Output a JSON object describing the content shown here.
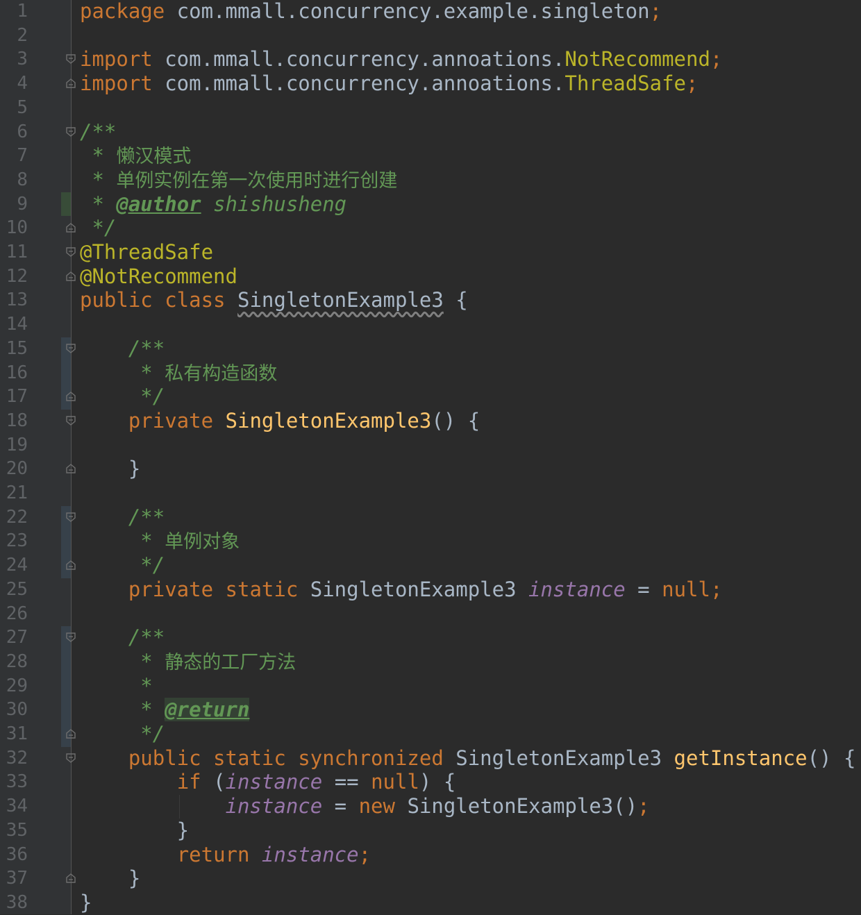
{
  "editor": {
    "file_language": "java",
    "colors": {
      "background": "#2b2b2b",
      "keyword": "#cc7832",
      "annotation": "#bbb529",
      "method": "#ffc66d",
      "field": "#9876aa",
      "doc_comment": "#629755",
      "line_number": "#606366"
    }
  },
  "lines": [
    {
      "n": "1",
      "tokens": [
        [
          "kw",
          "package"
        ],
        [
          "plain",
          " com.mmall.concurrency.example.singleton"
        ],
        [
          "kw",
          ";"
        ]
      ]
    },
    {
      "n": "2",
      "tokens": []
    },
    {
      "n": "3",
      "fold": "open",
      "tokens": [
        [
          "kw",
          "import"
        ],
        [
          "plain",
          " com.mmall.concurrency.annoations."
        ],
        [
          "ann",
          "NotRecommend"
        ],
        [
          "kw",
          ";"
        ]
      ]
    },
    {
      "n": "4",
      "fold": "close",
      "tokens": [
        [
          "kw",
          "import"
        ],
        [
          "plain",
          " com.mmall.concurrency.annoations."
        ],
        [
          "ann",
          "ThreadSafe"
        ],
        [
          "kw",
          ";"
        ]
      ]
    },
    {
      "n": "5",
      "tokens": []
    },
    {
      "n": "6",
      "fold": "open",
      "tokens": [
        [
          "doc",
          "/**"
        ]
      ]
    },
    {
      "n": "7",
      "tokens": [
        [
          "doc",
          " * "
        ],
        [
          "doctext",
          "懒汉模式"
        ]
      ]
    },
    {
      "n": "8",
      "tokens": [
        [
          "doc",
          " * "
        ],
        [
          "doctext",
          "单例实例在第一次使用时进行创建"
        ]
      ]
    },
    {
      "n": "9",
      "tokens": [
        [
          "doc",
          " * "
        ],
        [
          "doctag",
          "@author"
        ],
        [
          "docauthor",
          " shishusheng"
        ]
      ]
    },
    {
      "n": "10",
      "fold": "close",
      "tokens": [
        [
          "doc",
          " */"
        ]
      ]
    },
    {
      "n": "11",
      "fold": "open",
      "tokens": [
        [
          "ann",
          "@ThreadSafe"
        ]
      ]
    },
    {
      "n": "12",
      "fold": "close",
      "tokens": [
        [
          "ann",
          "@NotRecommend"
        ]
      ]
    },
    {
      "n": "13",
      "tokens": [
        [
          "kw",
          "public class "
        ],
        [
          "cls-unused",
          "SingletonExample3"
        ],
        [
          "plain",
          " {"
        ]
      ]
    },
    {
      "n": "14",
      "tokens": []
    },
    {
      "n": "15",
      "fold": "open",
      "tokens": [
        [
          "plain",
          "    "
        ],
        [
          "doc",
          "/**"
        ]
      ]
    },
    {
      "n": "16",
      "tokens": [
        [
          "doc",
          "     * "
        ],
        [
          "doctext",
          "私有构造函数"
        ]
      ]
    },
    {
      "n": "17",
      "fold": "close",
      "tokens": [
        [
          "doc",
          "     */"
        ]
      ]
    },
    {
      "n": "18",
      "fold": "open",
      "tokens": [
        [
          "plain",
          "    "
        ],
        [
          "kw",
          "private "
        ],
        [
          "method",
          "SingletonExample3"
        ],
        [
          "plain",
          "() {"
        ]
      ]
    },
    {
      "n": "19",
      "tokens": []
    },
    {
      "n": "20",
      "fold": "close",
      "tokens": [
        [
          "plain",
          "    }"
        ]
      ]
    },
    {
      "n": "21",
      "tokens": []
    },
    {
      "n": "22",
      "fold": "open",
      "tokens": [
        [
          "plain",
          "    "
        ],
        [
          "doc",
          "/**"
        ]
      ]
    },
    {
      "n": "23",
      "tokens": [
        [
          "doc",
          "     * "
        ],
        [
          "doctext",
          "单例对象"
        ]
      ]
    },
    {
      "n": "24",
      "fold": "close",
      "tokens": [
        [
          "doc",
          "     */"
        ]
      ]
    },
    {
      "n": "25",
      "tokens": [
        [
          "plain",
          "    "
        ],
        [
          "kw",
          "private static "
        ],
        [
          "plain",
          "SingletonExample3 "
        ],
        [
          "field",
          "instance"
        ],
        [
          "plain",
          " = "
        ],
        [
          "kw",
          "null;"
        ]
      ]
    },
    {
      "n": "26",
      "tokens": []
    },
    {
      "n": "27",
      "fold": "open",
      "tokens": [
        [
          "plain",
          "    "
        ],
        [
          "doc",
          "/**"
        ]
      ]
    },
    {
      "n": "28",
      "tokens": [
        [
          "doc",
          "     * "
        ],
        [
          "doctext",
          "静态的工厂方法"
        ]
      ]
    },
    {
      "n": "29",
      "tokens": [
        [
          "doc",
          "     *"
        ]
      ]
    },
    {
      "n": "30",
      "tokens": [
        [
          "doc",
          "     * "
        ],
        [
          "doctag-hl",
          "@return"
        ]
      ]
    },
    {
      "n": "31",
      "fold": "close",
      "tokens": [
        [
          "doc",
          "     */"
        ]
      ]
    },
    {
      "n": "32",
      "fold": "open",
      "tokens": [
        [
          "plain",
          "    "
        ],
        [
          "kw",
          "public static synchronized "
        ],
        [
          "plain",
          "SingletonExample3 "
        ],
        [
          "method",
          "getInstance"
        ],
        [
          "plain",
          "() {"
        ]
      ]
    },
    {
      "n": "33",
      "tokens": [
        [
          "plain",
          "        "
        ],
        [
          "kw",
          "if "
        ],
        [
          "plain",
          "("
        ],
        [
          "field",
          "instance"
        ],
        [
          "plain",
          " == "
        ],
        [
          "kw",
          "null"
        ],
        [
          "plain",
          ") {"
        ]
      ]
    },
    {
      "n": "34",
      "tokens": [
        [
          "plain",
          "            "
        ],
        [
          "field",
          "instance"
        ],
        [
          "plain",
          " = "
        ],
        [
          "kw",
          "new "
        ],
        [
          "plain",
          "SingletonExample3()"
        ],
        [
          "kw",
          ";"
        ]
      ]
    },
    {
      "n": "35",
      "tokens": [
        [
          "plain",
          "        }"
        ]
      ]
    },
    {
      "n": "36",
      "tokens": [
        [
          "plain",
          "        "
        ],
        [
          "kw",
          "return "
        ],
        [
          "field",
          "instance"
        ],
        [
          "kw",
          ";"
        ]
      ]
    },
    {
      "n": "37",
      "fold": "close",
      "tokens": [
        [
          "plain",
          "    }"
        ]
      ]
    },
    {
      "n": "38",
      "tokens": [
        [
          "plain",
          "}"
        ]
      ]
    }
  ]
}
